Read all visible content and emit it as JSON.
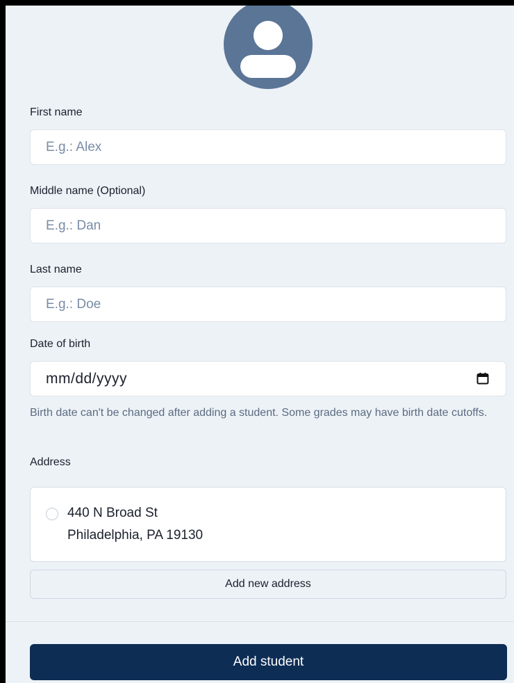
{
  "avatar": {
    "icon": "user-avatar-icon",
    "color": "#5a7596"
  },
  "form": {
    "first_name": {
      "label": "First name",
      "placeholder": "E.g.: Alex"
    },
    "middle_name": {
      "label": "Middle name (Optional)",
      "placeholder": "E.g.: Dan"
    },
    "last_name": {
      "label": "Last name",
      "placeholder": "E.g.: Doe"
    },
    "dob": {
      "label": "Date of birth",
      "value": "mm/dd/yyyy",
      "icon": "calendar-icon",
      "helper": "Birth date can't be changed after adding a student. Some grades may have birth date cutoffs."
    },
    "address": {
      "label": "Address",
      "options": [
        {
          "line1": "440 N Broad St",
          "line2": "Philadelphia, PA 19130",
          "selected": false
        }
      ],
      "add_label": "Add new address"
    }
  },
  "submit": {
    "label": "Add student",
    "color": "#0e2d55"
  }
}
